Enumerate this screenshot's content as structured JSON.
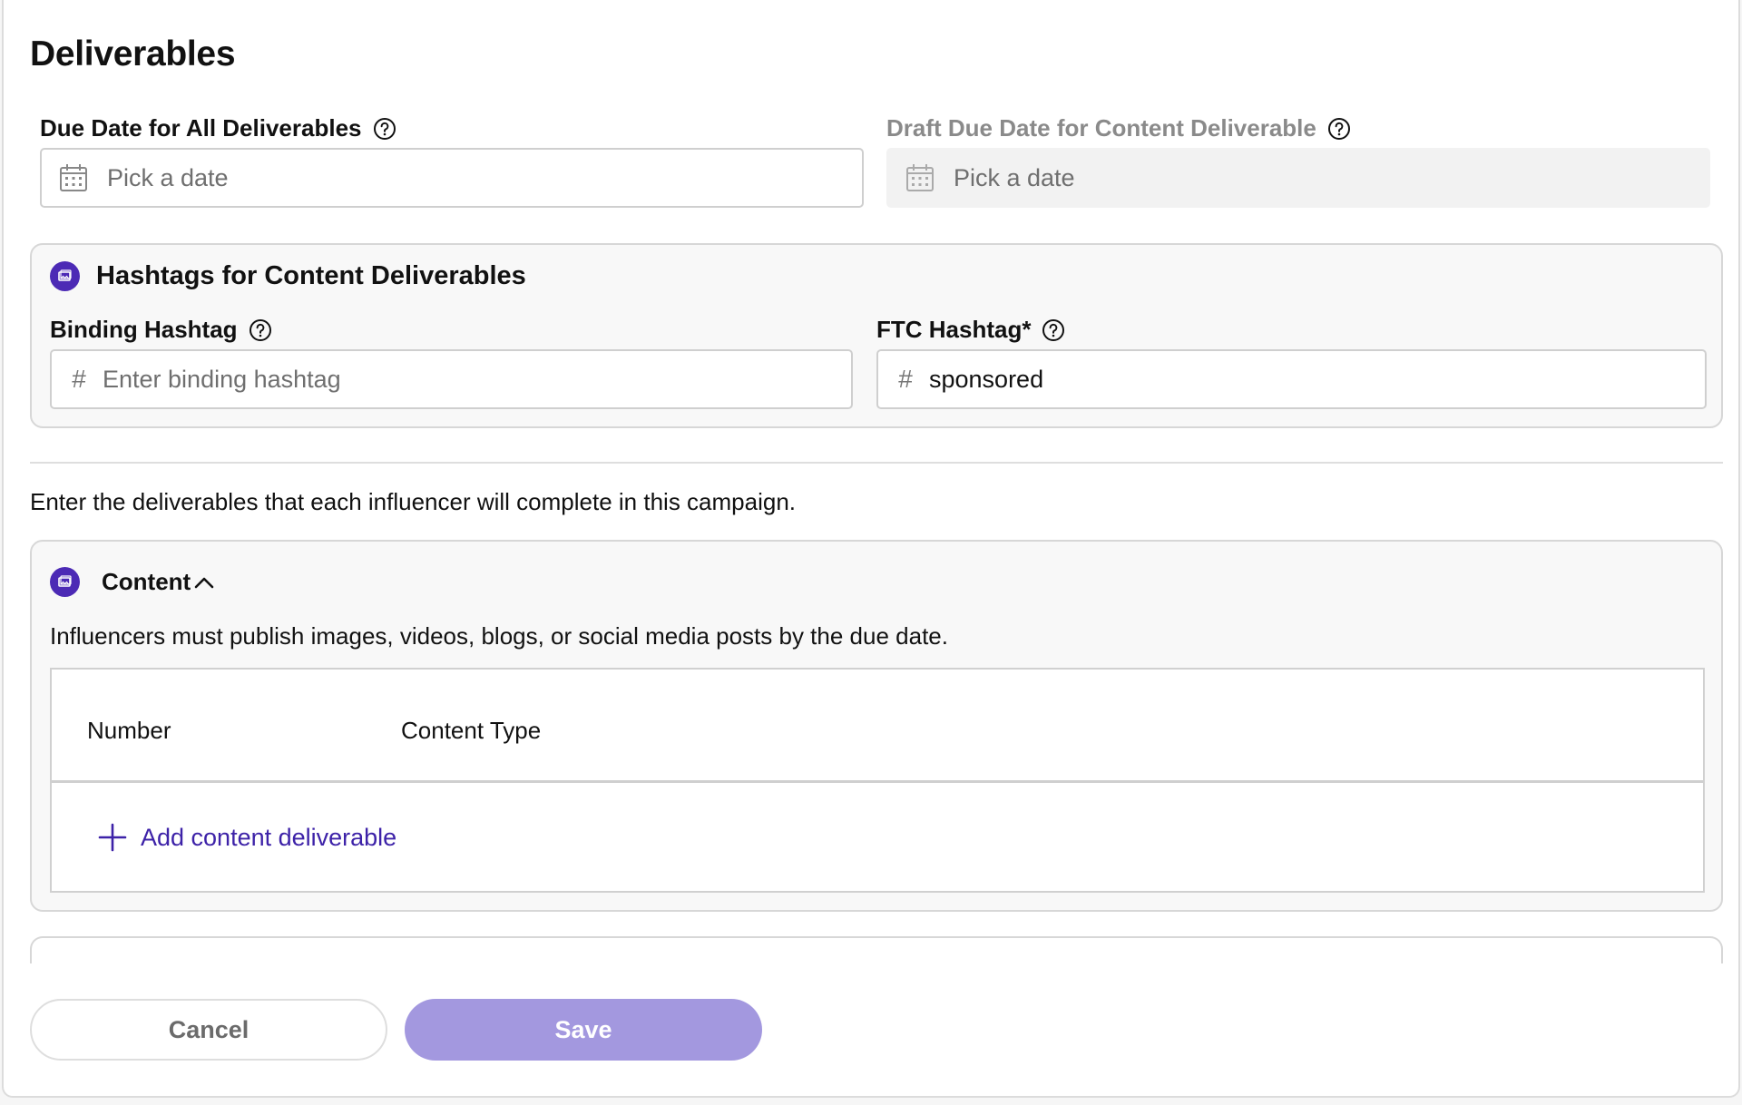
{
  "page": {
    "title": "Deliverables"
  },
  "due_date": {
    "label": "Due Date for All Deliverables",
    "placeholder": "Pick a date",
    "icon": "calendar-icon"
  },
  "draft_due_date": {
    "label": "Draft Due Date for Content Deliverable",
    "placeholder": "Pick a date",
    "icon": "calendar-icon",
    "disabled": true
  },
  "hashtags": {
    "title": "Hashtags for Content Deliverables",
    "binding": {
      "label": "Binding Hashtag",
      "prefix": "#",
      "placeholder": "Enter binding hashtag"
    },
    "ftc": {
      "label": "FTC Hashtag*",
      "prefix": "#",
      "value": "sponsored"
    }
  },
  "intro_text": "Enter the deliverables that each influencer will complete in this campaign.",
  "content": {
    "title": "Content",
    "expanded": true,
    "description": "Influencers must publish images, videos, blogs, or social media posts by the due date.",
    "columns": [
      "Number",
      "Content Type"
    ],
    "add_label": "Add content deliverable"
  },
  "actions": {
    "cancel": "Cancel",
    "save": "Save"
  },
  "colors": {
    "accent": "#4c2ab5",
    "link": "#3d22a8",
    "save_button": "#a398df"
  }
}
